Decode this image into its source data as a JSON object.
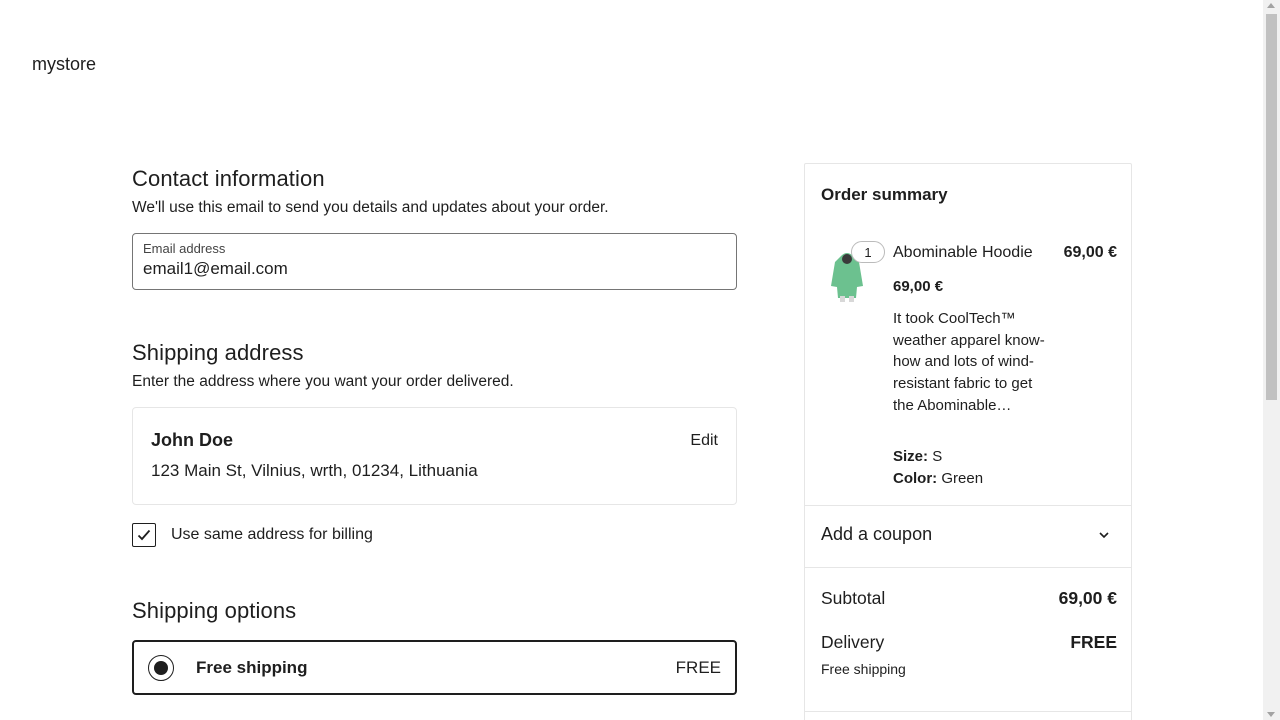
{
  "store": {
    "logo": "mystore"
  },
  "contact": {
    "title": "Contact information",
    "subtitle": "We'll use this email to send you details and updates about your order.",
    "email_label": "Email address",
    "email_value": "email1@email.com"
  },
  "shipping": {
    "title": "Shipping address",
    "subtitle": "Enter the address where you want your order delivered.",
    "name": "John Doe",
    "address": "123 Main St, Vilnius, wrth, 01234, Lithuania",
    "edit_label": "Edit",
    "billing_same_label": "Use same address for billing",
    "billing_same_checked": true
  },
  "shipping_options": {
    "title": "Shipping options",
    "selected": {
      "label": "Free shipping",
      "price": "FREE"
    }
  },
  "summary": {
    "title": "Order summary",
    "item": {
      "quantity": "1",
      "name": "Abominable Hoodie",
      "total": "69,00 €",
      "price": "69,00 €",
      "description": "It took CoolTech™ weather apparel know-how and lots of wind-resistant fabric to get the Abominable…",
      "size_label": "Size:",
      "size_value": "S",
      "color_label": "Color:",
      "color_value": "Green",
      "image_color": "#6cc18f"
    },
    "coupon_label": "Add a coupon",
    "subtotal_label": "Subtotal",
    "subtotal_value": "69,00 €",
    "delivery_label": "Delivery",
    "delivery_value": "FREE",
    "delivery_note": "Free shipping"
  }
}
